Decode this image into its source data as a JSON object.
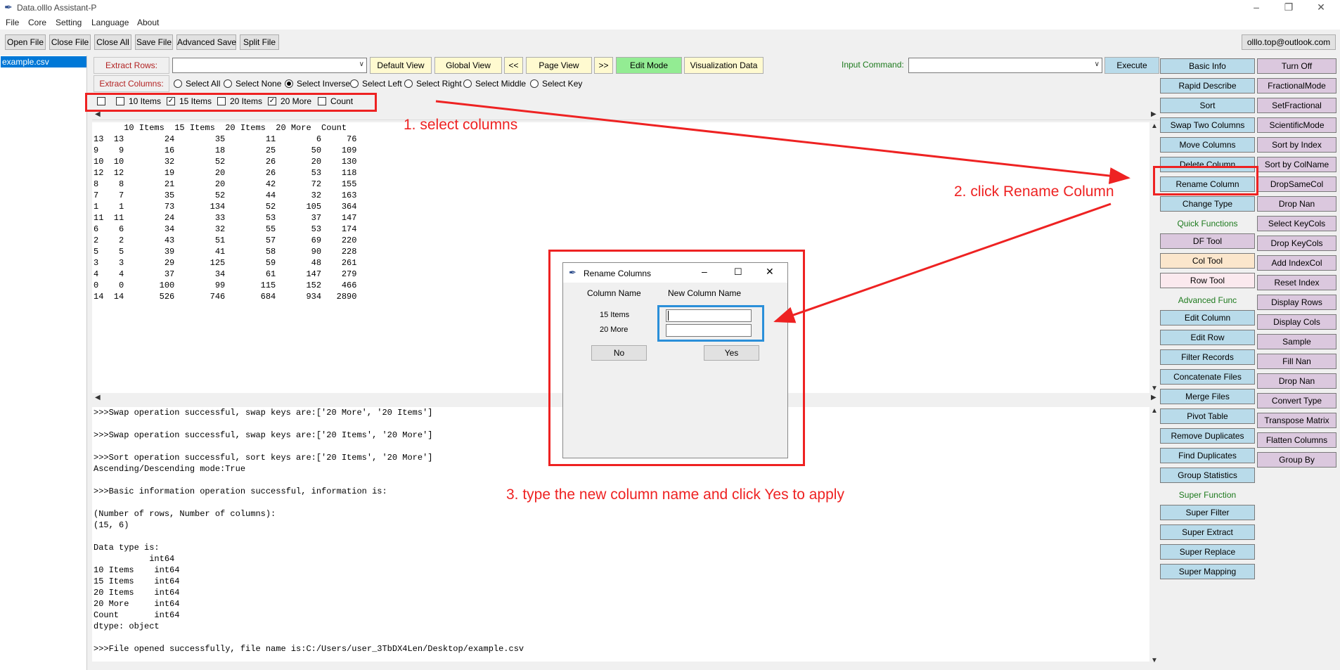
{
  "window": {
    "title": "Data.olllo Assistant-P"
  },
  "menubar": [
    "File",
    "Core",
    "Setting",
    "Language",
    "About"
  ],
  "toolbar": {
    "buttons": [
      "Open File",
      "Close File",
      "Close All",
      "Save File",
      "Advanced Save",
      "Split File"
    ],
    "account": "olllo.top@outlook.com"
  },
  "file_list": [
    "example.csv"
  ],
  "controls": {
    "extract_rows_label": "Extract Rows:",
    "extract_columns_label": "Extract Columns:",
    "view_buttons": [
      "Default View",
      "Global View",
      "<<",
      "Page View",
      ">>",
      "Edit Mode",
      "Visualization Data"
    ],
    "input_command_label": "Input Command:",
    "execute_label": "Execute",
    "radio_options": [
      "Select All",
      "Select None",
      "Select Inverse",
      "Select Left",
      "Select Right",
      "Select Middle",
      "Select Key"
    ],
    "radio_selected": "Select Inverse",
    "columns": [
      {
        "label": "",
        "checked": false
      },
      {
        "label": "10 Items",
        "checked": false
      },
      {
        "label": "15 Items",
        "checked": true
      },
      {
        "label": "20 Items",
        "checked": false
      },
      {
        "label": "20 More",
        "checked": true
      },
      {
        "label": "Count",
        "checked": false
      }
    ]
  },
  "data_table": {
    "text": "      10 Items  15 Items  20 Items  20 More  Count\n13  13        24        35        11        6     76\n9    9        16        18        25       50    109\n10  10        32        52        26       20    130\n12  12        19        20        26       53    118\n8    8        21        20        42       72    155\n7    7        35        52        44       32    163\n1    1        73       134        52      105    364\n11  11        24        33        53       37    147\n6    6        34        32        55       53    174\n2    2        43        51        57       69    220\n5    5        39        41        58       90    228\n3    3        29       125        59       48    261\n4    4        37        34        61      147    279\n0    0       100        99       115      152    466\n14  14       526       746       684      934   2890"
  },
  "log": {
    "text": ">>>Swap operation successful, swap keys are:['20 More', '20 Items']\n\n>>>Swap operation successful, swap keys are:['20 Items', '20 More']\n\n>>>Sort operation successful, sort keys are:['20 Items', '20 More']\nAscending/Descending mode:True\n\n>>>Basic information operation successful, information is:\n\n(Number of rows, Number of columns):\n(15, 6)\n\nData type is:\n           int64\n10 Items    int64\n15 Items    int64\n20 Items    int64\n20 More     int64\nCount       int64\ndtype: object\n\n>>>File opened successfully, file name is:C:/Users/user_3TbDX4Len/Desktop/example.csv"
  },
  "right_panel": {
    "col1": [
      {
        "t": "btn",
        "label": "Basic Info",
        "color": "blue"
      },
      {
        "t": "btn",
        "label": "Rapid Describe",
        "color": "blue"
      },
      {
        "t": "btn",
        "label": "Sort",
        "color": "blue"
      },
      {
        "t": "btn",
        "label": "Swap Two Columns",
        "color": "blue"
      },
      {
        "t": "btn",
        "label": "Move Columns",
        "color": "blue"
      },
      {
        "t": "btn",
        "label": "Delete Column",
        "color": "blue"
      },
      {
        "t": "btn",
        "label": "Rename Column",
        "color": "blue"
      },
      {
        "t": "btn",
        "label": "Change Type",
        "color": "blue"
      },
      {
        "t": "sect",
        "label": "Quick Functions"
      },
      {
        "t": "btn",
        "label": "DF Tool",
        "color": "purple"
      },
      {
        "t": "btn",
        "label": "Col Tool",
        "color": "peach"
      },
      {
        "t": "btn",
        "label": "Row Tool",
        "color": "pink"
      },
      {
        "t": "sect",
        "label": "Advanced Func"
      },
      {
        "t": "btn",
        "label": "Edit Column",
        "color": "blue"
      },
      {
        "t": "btn",
        "label": "Edit Row",
        "color": "blue"
      },
      {
        "t": "btn",
        "label": "Filter Records",
        "color": "blue"
      },
      {
        "t": "btn",
        "label": "Concatenate Files",
        "color": "blue"
      },
      {
        "t": "btn",
        "label": "Merge Files",
        "color": "blue"
      },
      {
        "t": "btn",
        "label": "Pivot Table",
        "color": "blue"
      },
      {
        "t": "btn",
        "label": "Remove Duplicates",
        "color": "blue"
      },
      {
        "t": "btn",
        "label": "Find Duplicates",
        "color": "blue"
      },
      {
        "t": "btn",
        "label": "Group Statistics",
        "color": "blue"
      },
      {
        "t": "sect",
        "label": "Super Function"
      },
      {
        "t": "btn",
        "label": "Super Filter",
        "color": "blue"
      },
      {
        "t": "btn",
        "label": "Super Extract",
        "color": "blue"
      },
      {
        "t": "btn",
        "label": "Super Replace",
        "color": "blue"
      },
      {
        "t": "btn",
        "label": "Super Mapping",
        "color": "blue"
      }
    ],
    "col2": [
      "Turn Off",
      "FractionalMode",
      "SetFractional",
      "ScientificMode",
      "Sort by Index",
      "Sort by ColName",
      "DropSameCol",
      "Drop Nan",
      "Select KeyCols",
      "Drop KeyCols",
      "Add IndexCol",
      "Reset Index",
      "Display Rows",
      "Display Cols",
      "Sample",
      "Fill Nan",
      "Drop Nan",
      "Convert Type",
      "Transpose Matrix",
      "Flatten Columns",
      "Group By"
    ]
  },
  "dialog": {
    "title": "Rename Columns",
    "col_header": "Column Name",
    "new_header": "New Column Name",
    "rows": [
      "15 Items",
      "20 More"
    ],
    "no_label": "No",
    "yes_label": "Yes"
  },
  "annotations": {
    "step1": "1. select columns",
    "step2": "2. click Rename Column",
    "step3": "3. type the new column name and click Yes to apply",
    "color": "#ee2222"
  }
}
